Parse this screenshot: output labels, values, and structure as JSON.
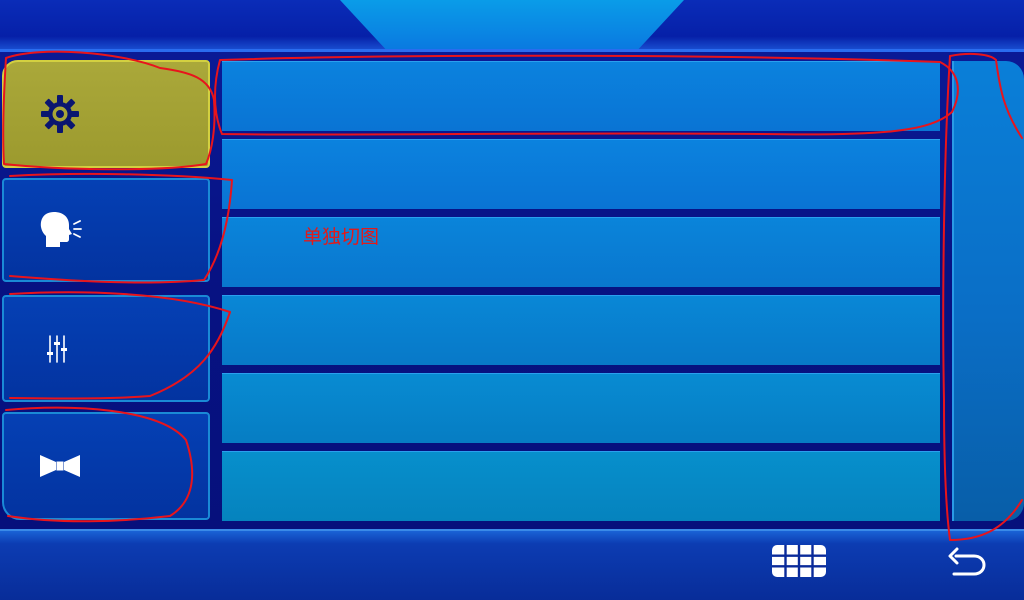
{
  "sidebar": {
    "items": [
      {
        "icon": "gear-icon",
        "active": true
      },
      {
        "icon": "speaking-head-icon",
        "active": false
      },
      {
        "icon": "equalizer-sliders-icon",
        "active": false
      },
      {
        "icon": "bowtie-icon",
        "active": false
      }
    ]
  },
  "content": {
    "row_count": 6,
    "annotation": "单独切图"
  },
  "bottom_bar": {
    "icons": [
      "grid-menu-icon",
      "back-arrow-icon"
    ]
  },
  "colors": {
    "background": "#06107a",
    "active_tab": "#aaa83a",
    "inactive_tab": "#0540b4",
    "row_fill": "#0a7ad8",
    "annotation": "#e21a1a"
  }
}
